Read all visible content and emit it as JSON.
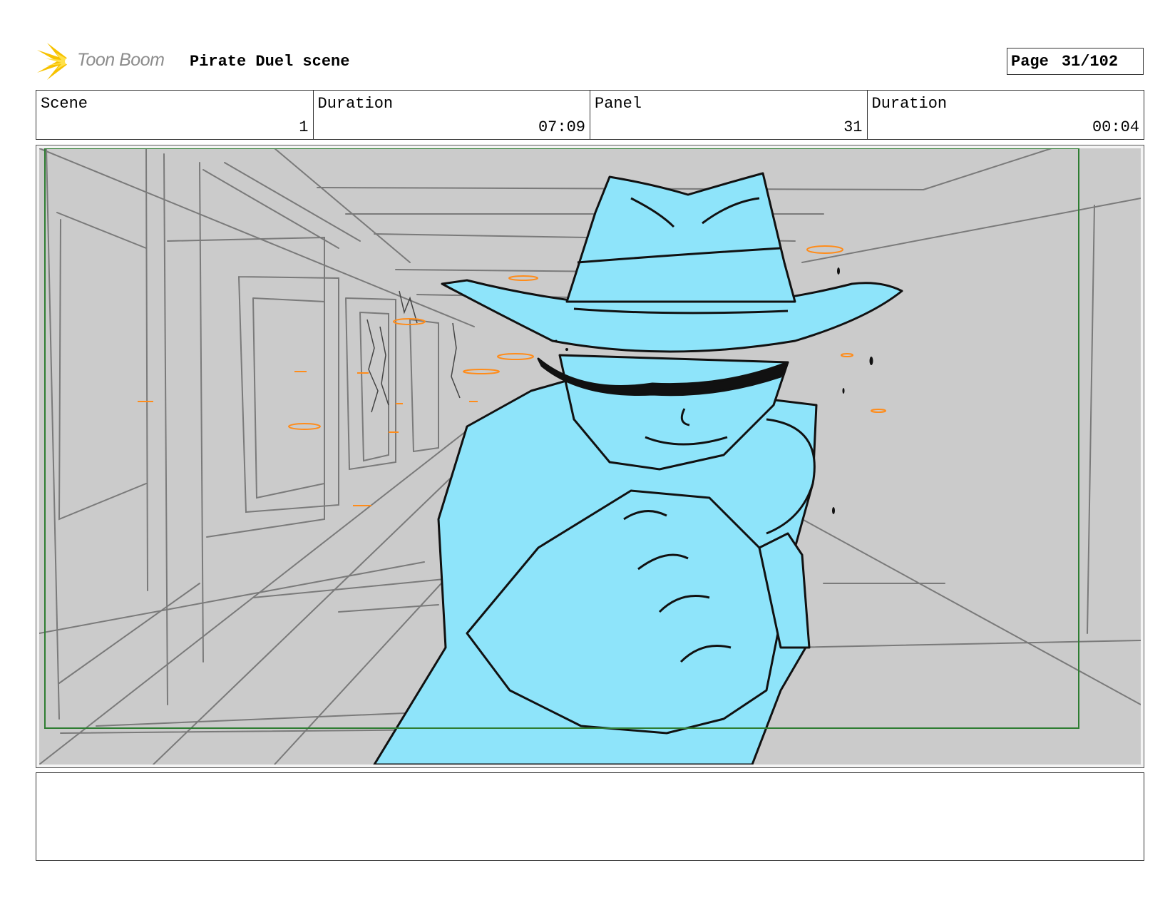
{
  "header": {
    "logo_text": "Toon Boom",
    "title": "Pirate Duel scene",
    "page_label": "Page",
    "page_value": "31/102"
  },
  "info_bar": [
    {
      "label": "Scene",
      "value": "1"
    },
    {
      "label": "Duration",
      "value": "07:09"
    },
    {
      "label": "Panel",
      "value": "31"
    },
    {
      "label": "Duration",
      "value": "00:04"
    }
  ],
  "panel": {
    "description": "",
    "safe_frame_color": "#2e7d32",
    "character_fill": "#8ee4fa",
    "background_fill": "#cbcbcb",
    "accent_color": "#ff8c1a"
  },
  "notes": {
    "text": ""
  }
}
